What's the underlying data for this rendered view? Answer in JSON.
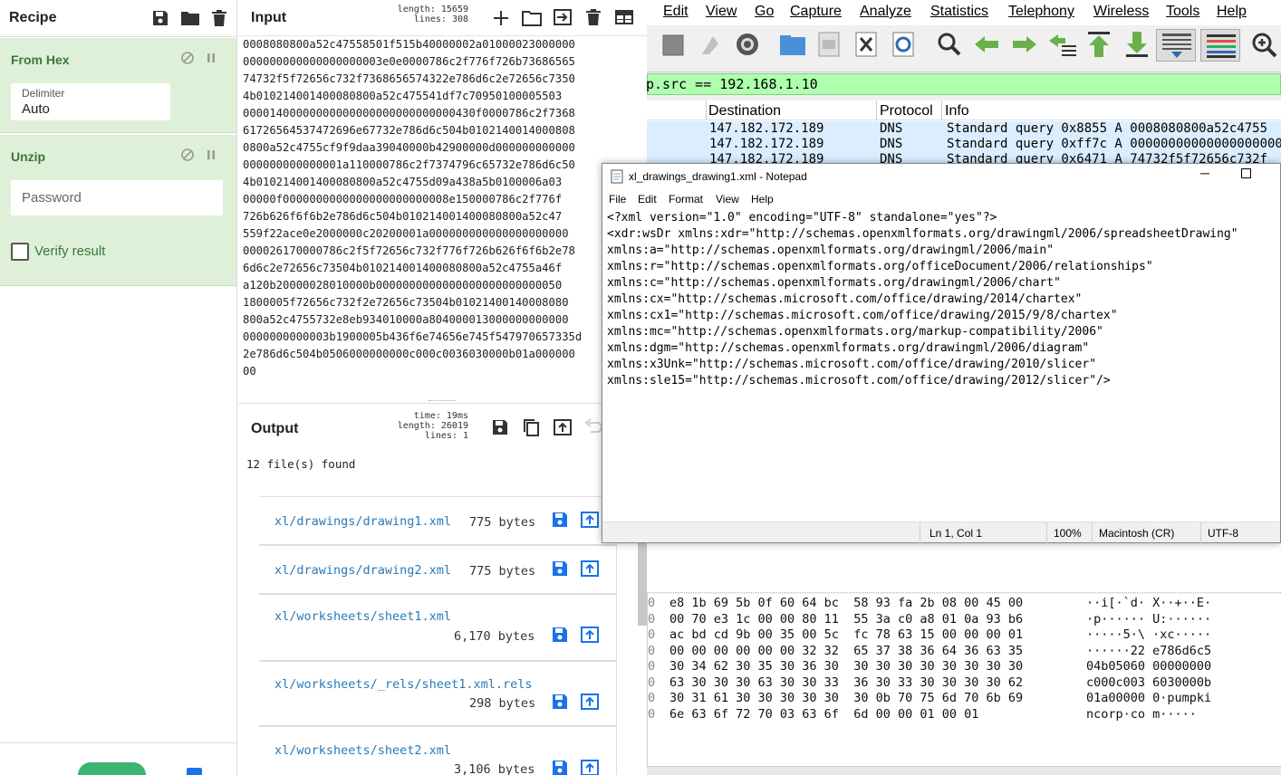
{
  "recipe": {
    "title": "Recipe",
    "from_hex": {
      "name": "From Hex",
      "delimiter_label": "Delimiter",
      "delimiter_value": "Auto"
    },
    "unzip": {
      "name": "Unzip",
      "password_placeholder": "Password",
      "verify_label": "Verify result"
    }
  },
  "input": {
    "title": "Input",
    "length_label": "length:",
    "length": "15659",
    "lines_label": "lines:",
    "lines": "308",
    "hex_lines": [
      "0008080800a52c47558501f515b40000002a01000023000000",
      "000000000000000000003e0e0000786c2f776f726b73686565",
      "74732f5f72656c732f7368656574322e786d6c2e72656c7350",
      "4b010214001400080800a52c475541df7c70950100005503",
      "00001400000000000000000000000000430f0000786c2f7368",
      "61726564537472696e67732e786d6c504b0102140014000808",
      "0800a52c4755cf9f9daa39040000b42900000d000000000000",
      "000000000000001a110000786c2f7374796c65732e786d6c50",
      "4b010214001400080800a52c4755d09a438a5b0100006a03",
      "00000f0000000000000000000000008e150000786c2f776f",
      "726b626f6f6b2e786d6c504b010214001400080800a52c47",
      "559f22ace0e2000000c20200001a000000000000000000000",
      "000026170000786c2f5f72656c732f776f726b626f6f6b2e78",
      "6d6c2e72656c73504b010214001400080800a52c4755a46f",
      "a120b20000028010000b0000000000000000000000000050",
      "1800005f72656c732f2e72656c73504b01021400140008080",
      "800a52c4755732e8eb934010000a804000013000000000000",
      "0000000000003b1900005b436f6e74656e745f547970657335d",
      "2e786d6c504b0506000000000c000c0036030000b01a000000",
      "00"
    ]
  },
  "output": {
    "title": "Output",
    "time_label": "time:",
    "time": "19ms",
    "length_label": "length:",
    "length": "26019",
    "lines_label": "lines:",
    "lines": "1",
    "files_found": "12 file(s) found",
    "files": [
      {
        "name": "xl/drawings/drawing1.xml",
        "size": "775 bytes"
      },
      {
        "name": "xl/drawings/drawing2.xml",
        "size": "775 bytes"
      },
      {
        "name": "xl/worksheets/sheet1.xml",
        "size": "6,170 bytes"
      },
      {
        "name": "xl/worksheets/_rels/sheet1.xml.rels",
        "size": "298 bytes"
      },
      {
        "name": "xl/worksheets/sheet2.xml",
        "size": "3,106 bytes"
      }
    ]
  },
  "wireshark": {
    "menu": [
      "Edit",
      "View",
      "Go",
      "Capture",
      "Analyze",
      "Statistics",
      "Telephony",
      "Wireless",
      "Tools",
      "Help"
    ],
    "filter": "p.src == 192.168.1.10",
    "columns": [
      "Destination",
      "Protocol",
      "Info"
    ],
    "packets": [
      {
        "dest": "147.182.172.189",
        "proto": "DNS",
        "info": "Standard query 0x8855 A 0008080800a52c4755"
      },
      {
        "dest": "147.182.172.189",
        "proto": "DNS",
        "info": "Standard query 0xff7c A 00000000000000000000"
      },
      {
        "dest": "147.182.172.189",
        "proto": "DNS",
        "info": "Standard query 0x6471 A 74732f5f72656c732f"
      }
    ],
    "hex_rows": [
      {
        "off": "0",
        "hex": "e8 1b 69 5b 0f 60 64 bc  58 93 fa 2b 08 00 45 00",
        "ascii": "··i[·`d· X··+··E·"
      },
      {
        "off": "0",
        "hex": "00 70 e3 1c 00 00 80 11  55 3a c0 a8 01 0a 93 b6",
        "ascii": "·p······ U:······"
      },
      {
        "off": "0",
        "hex": "ac bd cd 9b 00 35 00 5c  fc 78 63 15 00 00 00 01",
        "ascii": "·····5·\\ ·xc·····"
      },
      {
        "off": "0",
        "hex": "00 00 00 00 00 00 32 32  65 37 38 36 64 36 63 35",
        "ascii": "······22 e786d6c5"
      },
      {
        "off": "0",
        "hex": "30 34 62 30 35 30 36 30  30 30 30 30 30 30 30 30",
        "ascii": "04b05060 00000000"
      },
      {
        "off": "0",
        "hex": "63 30 30 30 63 30 30 33  36 30 33 30 30 30 30 62",
        "ascii": "c000c003 6030000b"
      },
      {
        "off": "0",
        "hex": "30 31 61 30 30 30 30 30  30 0b 70 75 6d 70 6b 69",
        "ascii": "01a00000 0·pumpki"
      },
      {
        "off": "0",
        "hex": "6e 63 6f 72 70 03 63 6f  6d 00 00 01 00 01",
        "ascii": "ncorp·co m·····"
      }
    ]
  },
  "notepad": {
    "title": "xl_drawings_drawing1.xml - Notepad",
    "menu": [
      "File",
      "Edit",
      "Format",
      "View",
      "Help"
    ],
    "lines": [
      "<?xml version=\"1.0\" encoding=\"UTF-8\" standalone=\"yes\"?>",
      "<xdr:wsDr xmlns:xdr=\"http://schemas.openxmlformats.org/drawingml/2006/spreadsheetDrawing\"",
      "xmlns:a=\"http://schemas.openxmlformats.org/drawingml/2006/main\"",
      "xmlns:r=\"http://schemas.openxmlformats.org/officeDocument/2006/relationships\"",
      "xmlns:c=\"http://schemas.openxmlformats.org/drawingml/2006/chart\"",
      "xmlns:cx=\"http://schemas.microsoft.com/office/drawing/2014/chartex\"",
      "xmlns:cx1=\"http://schemas.microsoft.com/office/drawing/2015/9/8/chartex\"",
      "xmlns:mc=\"http://schemas.openxmlformats.org/markup-compatibility/2006\"",
      "xmlns:dgm=\"http://schemas.openxmlformats.org/drawingml/2006/diagram\"",
      "xmlns:x3Unk=\"http://schemas.microsoft.com/office/drawing/2010/slicer\"",
      "xmlns:sle15=\"http://schemas.microsoft.com/office/drawing/2012/slicer\"/>"
    ],
    "status": {
      "position": "Ln 1, Col 1",
      "zoom": "100%",
      "eol": "Macintosh (CR)",
      "encoding": "UTF-8"
    }
  },
  "colors": {
    "op_green_bg": "#dff0d8",
    "op_green_text": "#3c763d",
    "filter_green": "#afffaf",
    "link_blue": "#2a7ab8",
    "save_blue": "#1a73e8"
  }
}
